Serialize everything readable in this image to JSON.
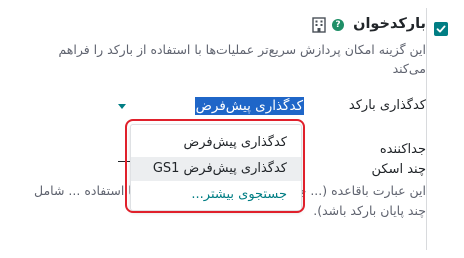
{
  "setting": {
    "title": "بارکدخوان",
    "help_glyph": "?",
    "checked": true,
    "description": "این گزینه امکان پردازش سریع‌تر عملیات‌ها با استفاده از بارکد را فراهم می‌کند"
  },
  "nomenclature": {
    "label": "کدگذاری بارکد",
    "value": "کدگذاری پیش‌فرض",
    "options": [
      "کدگذاری پیش‌فرض",
      "کدگذاری پیش‌فرض GS1",
      "جستجوی بیشتر..."
    ]
  },
  "separator": {
    "label_line1": "جداکننده",
    "label_line2": "چند اسکن"
  },
  "info_text": "این عبارت باقاعده (... جمیع شده، برای جدا کردن بارکدها استفاده ... شامل چند پایان بارکد باشد).",
  "colors": {
    "accent": "#017e84",
    "highlight": "#e0202b",
    "selection": "#1f66c8"
  }
}
